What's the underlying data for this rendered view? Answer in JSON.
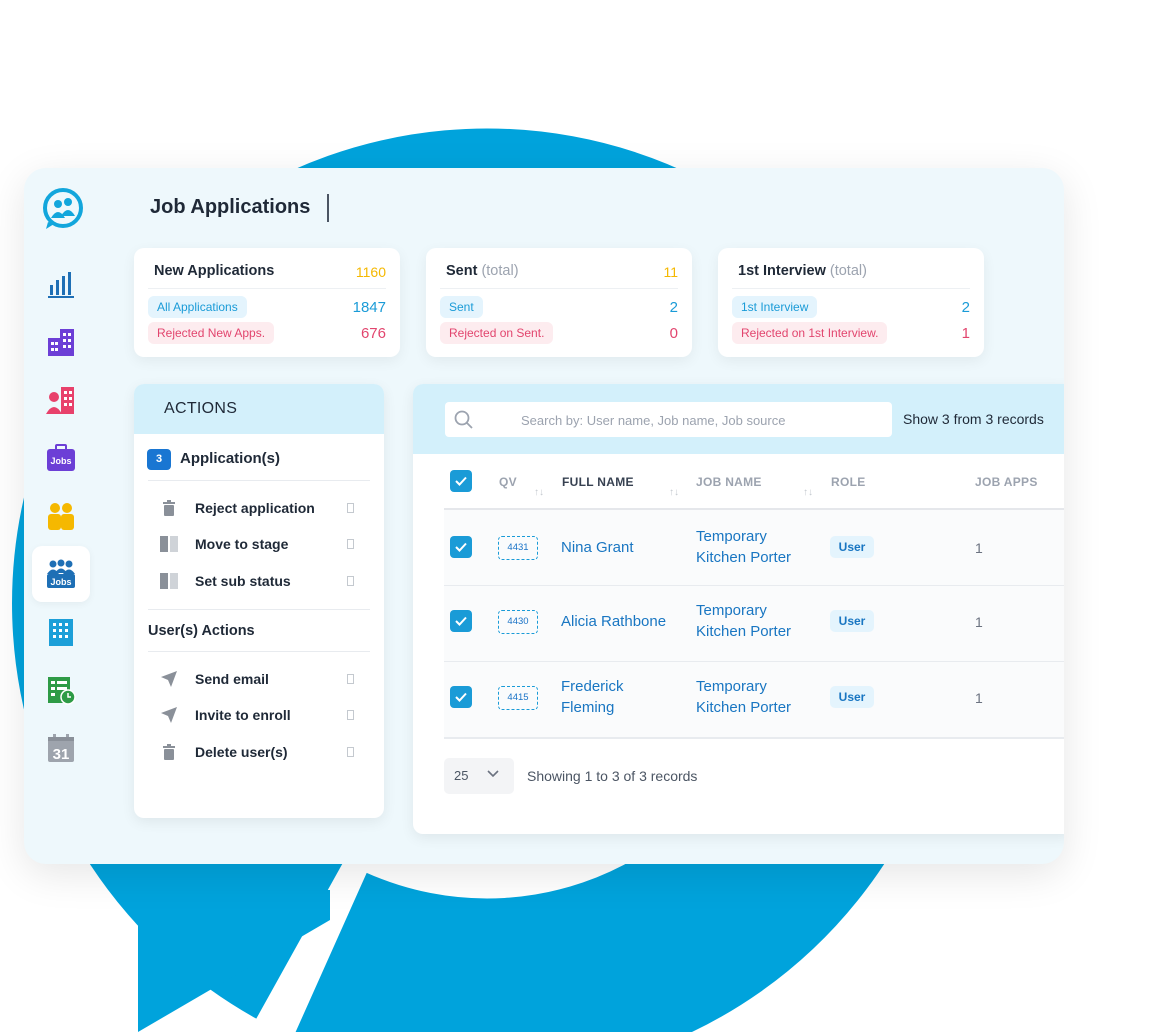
{
  "page_title": "Job Applications",
  "nav": {
    "items": [
      {
        "name": "analytics"
      },
      {
        "name": "companies"
      },
      {
        "name": "users"
      },
      {
        "name": "jobs",
        "label": "Jobs"
      },
      {
        "name": "candidates"
      },
      {
        "name": "job-applications",
        "label": "Jobs",
        "active": true
      },
      {
        "name": "buildings"
      },
      {
        "name": "timesheets"
      },
      {
        "name": "calendar",
        "label": "31"
      }
    ]
  },
  "stats": [
    {
      "title": "New Applications",
      "suffix": "",
      "total": "1160",
      "blue_label": "All Applications",
      "blue_value": "1847",
      "red_label": "Rejected New Apps.",
      "red_value": "676"
    },
    {
      "title": "Sent",
      "suffix": "(total)",
      "total": "11",
      "blue_label": "Sent",
      "blue_value": "2",
      "red_label": "Rejected on Sent.",
      "red_value": "0"
    },
    {
      "title": "1st Interview",
      "suffix": "(total)",
      "total": "",
      "blue_label": "1st Interview",
      "blue_value": "2",
      "red_label": "Rejected on 1st Interview.",
      "red_value": "1"
    }
  ],
  "actions": {
    "header": "ACTIONS",
    "count": "3",
    "applications_label": "Application(s)",
    "application_actions": [
      {
        "label": "Reject application",
        "icon": "trash-icon"
      },
      {
        "label": "Move to stage",
        "icon": "columns-icon"
      },
      {
        "label": "Set sub status",
        "icon": "columns-icon"
      }
    ],
    "users_label": "User(s) Actions",
    "user_actions": [
      {
        "label": "Send email",
        "icon": "send-icon"
      },
      {
        "label": "Invite to enroll",
        "icon": "send-icon"
      },
      {
        "label": "Delete user(s)",
        "icon": "trash-icon"
      }
    ]
  },
  "table": {
    "search_placeholder": "Search by: User name, Job name, Job source",
    "show_text": "Show 3 from 3 records",
    "columns": [
      "QV",
      "FULL NAME",
      "JOB NAME",
      "ROLE",
      "JOB APPS"
    ],
    "rows": [
      {
        "qv": "4431",
        "name": "Nina Grant",
        "job": "Temporary Kitchen Porter",
        "role": "User",
        "job_apps": "1",
        "checked": true
      },
      {
        "qv": "4430",
        "name": "Alicia Rathbone",
        "job": "Temporary Kitchen Porter",
        "role": "User",
        "job_apps": "1",
        "checked": true
      },
      {
        "qv": "4415",
        "name": "Frederick Fleming",
        "job": "Temporary Kitchen Porter",
        "role": "User",
        "job_apps": "1",
        "checked": true
      }
    ],
    "page_size": "25",
    "showing": "Showing 1 to 3 of 3 records"
  },
  "colors": {
    "brand": "#00a3dc",
    "accent_blue": "#1a9bd7",
    "accent_red": "#e2456e",
    "accent_yellow": "#f5b800"
  }
}
